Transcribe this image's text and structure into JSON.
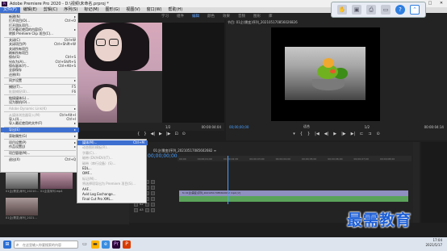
{
  "window": {
    "title": "Adobe Premiere Pro 2020 - D:\\视频\\未命名.prproj *",
    "buttons": [
      "—",
      "□",
      "✕"
    ]
  },
  "menubar": [
    "文件(F)",
    "编辑(E)",
    "剪辑(C)",
    "序列(S)",
    "标记(M)",
    "图形(G)",
    "视图(V)",
    "窗口(W)",
    "帮助(H)"
  ],
  "workspaces": [
    "学习",
    "组件",
    "编辑",
    "颜色",
    "效果",
    "音频",
    "图形",
    "库"
  ],
  "source_monitor": {
    "timecode": "00;00;00;00",
    "zoom": "1/2",
    "duration": "00:00:04:04"
  },
  "program_monitor": {
    "title": "节目: 01企(需变)序列_202105170856026826",
    "timecode_left": "00;00;00;00",
    "fit": "适合",
    "scale": "1/2",
    "timecode_right": "00:00:04:14"
  },
  "file_menu": [
    {
      "label": "新建(N)",
      "sc": "▸"
    },
    {
      "label": "打开项目(O)...",
      "sc": "Ctrl+O"
    },
    {
      "label": "打开团队项目...",
      "sc": ""
    },
    {
      "label": "打开最近使用的内容(E)",
      "sc": "▸"
    },
    {
      "label": "转换 Premiere Clip 项目(C)...",
      "sc": ""
    },
    {
      "sep": true
    },
    {
      "label": "关闭(C)",
      "sc": "Ctrl+W"
    },
    {
      "label": "关闭项目(P)",
      "sc": "Ctrl+Shift+W"
    },
    {
      "label": "关闭所有项目",
      "sc": ""
    },
    {
      "label": "刷新所有项目",
      "sc": ""
    },
    {
      "label": "保存(S)",
      "sc": "Ctrl+S"
    },
    {
      "label": "另存为(A)...",
      "sc": "Ctrl+Shift+S"
    },
    {
      "label": "保存副本(Y)...",
      "sc": "Ctrl+Alt+S"
    },
    {
      "label": "全部保存",
      "sc": ""
    },
    {
      "label": "还原(R)",
      "sc": ""
    },
    {
      "sep": true
    },
    {
      "label": "同步设置",
      "sc": "▸"
    },
    {
      "sep": true
    },
    {
      "label": "捕捉(T)...",
      "sc": "F5"
    },
    {
      "label": "批量捕捉(B)...",
      "sc": "F6",
      "dis": true
    },
    {
      "sep": true
    },
    {
      "label": "链接媒体(L)...",
      "sc": ""
    },
    {
      "label": "设为脱机(O)...",
      "sc": ""
    },
    {
      "sep": true
    },
    {
      "label": "Adobe Dynamic Link(K)",
      "sc": "▸",
      "dis": true
    },
    {
      "sep": true
    },
    {
      "label": "从媒体浏览器导入(M)",
      "sc": "Ctrl+Alt+I",
      "dis": true
    },
    {
      "label": "导入(I)...",
      "sc": "Ctrl+I"
    },
    {
      "label": "导入最近使用的文件(F)",
      "sc": "▸"
    },
    {
      "sep": true
    },
    {
      "label": "导出(E)",
      "sc": "▸",
      "hl": true
    },
    {
      "sep": true
    },
    {
      "label": "获取属性(G)",
      "sc": "▸"
    },
    {
      "sep": true
    },
    {
      "label": "项目设置(P)",
      "sc": "▸"
    },
    {
      "label": "作品设置(J)",
      "sc": "▸"
    },
    {
      "sep": true
    },
    {
      "label": "项目管理(M)...",
      "sc": ""
    },
    {
      "sep": true
    },
    {
      "label": "退出(X)",
      "sc": "Ctrl+Q"
    }
  ],
  "export_submenu": [
    {
      "label": "媒体(M)...",
      "sc": "Ctrl+M",
      "hl": true
    },
    {
      "label": "动态图形模板(R)...",
      "sc": "",
      "dis": true
    },
    {
      "label": "字幕(C)...",
      "sc": "",
      "dis": true
    },
    {
      "label": "磁带 (DV/HDV)(T)...",
      "sc": "",
      "dis": true
    },
    {
      "label": "磁带（串行设备）(S)...",
      "sc": "",
      "dis": true
    },
    {
      "label": "EDL...",
      "sc": ""
    },
    {
      "label": "OMF...",
      "sc": ""
    },
    {
      "label": "标记(M)...",
      "sc": "",
      "dis": true
    },
    {
      "label": "将选择项导出为 Premiere 项目(S)...",
      "sc": "",
      "dis": true
    },
    {
      "label": "AAF...",
      "sc": ""
    },
    {
      "label": "Avid Log Exchange...",
      "sc": ""
    },
    {
      "label": "Final Cut Pro XML...",
      "sc": ""
    }
  ],
  "timeline": {
    "header": "01企(需变)序列_20210517085602682 ≡",
    "timecode": "00;00;00;00",
    "ruler": [
      "00;00",
      "00;00;01;00",
      "00;00;02;00",
      "00;00;03;00",
      "00;00;04;00",
      "00;00;05;00",
      "00;00;06;00",
      "00;00;07;00",
      "00;00;08;00"
    ],
    "tracks": [
      "V3",
      "V2",
      "V1",
      "A1",
      "A2",
      "A3"
    ],
    "clip_v": "fx 01企(需变)序列_20210517085602682 mp4 [V]",
    "clip_a": ""
  },
  "project": {
    "items": [
      "01企(需变)序列_20210...",
      "01企变序列.mp4",
      "01企(需变)序列_2021..."
    ],
    "count": ""
  },
  "watermark": "最需教育",
  "taskbar": {
    "search_placeholder": "在这里输入你要搜索的内容",
    "time": "17:04",
    "date": "2021/5/17"
  },
  "colors": {
    "accent": "#3d6fd1",
    "timecode": "#4aa0ff",
    "clip_video": "#8f8fc0",
    "clip_audio": "#5aa35a"
  }
}
